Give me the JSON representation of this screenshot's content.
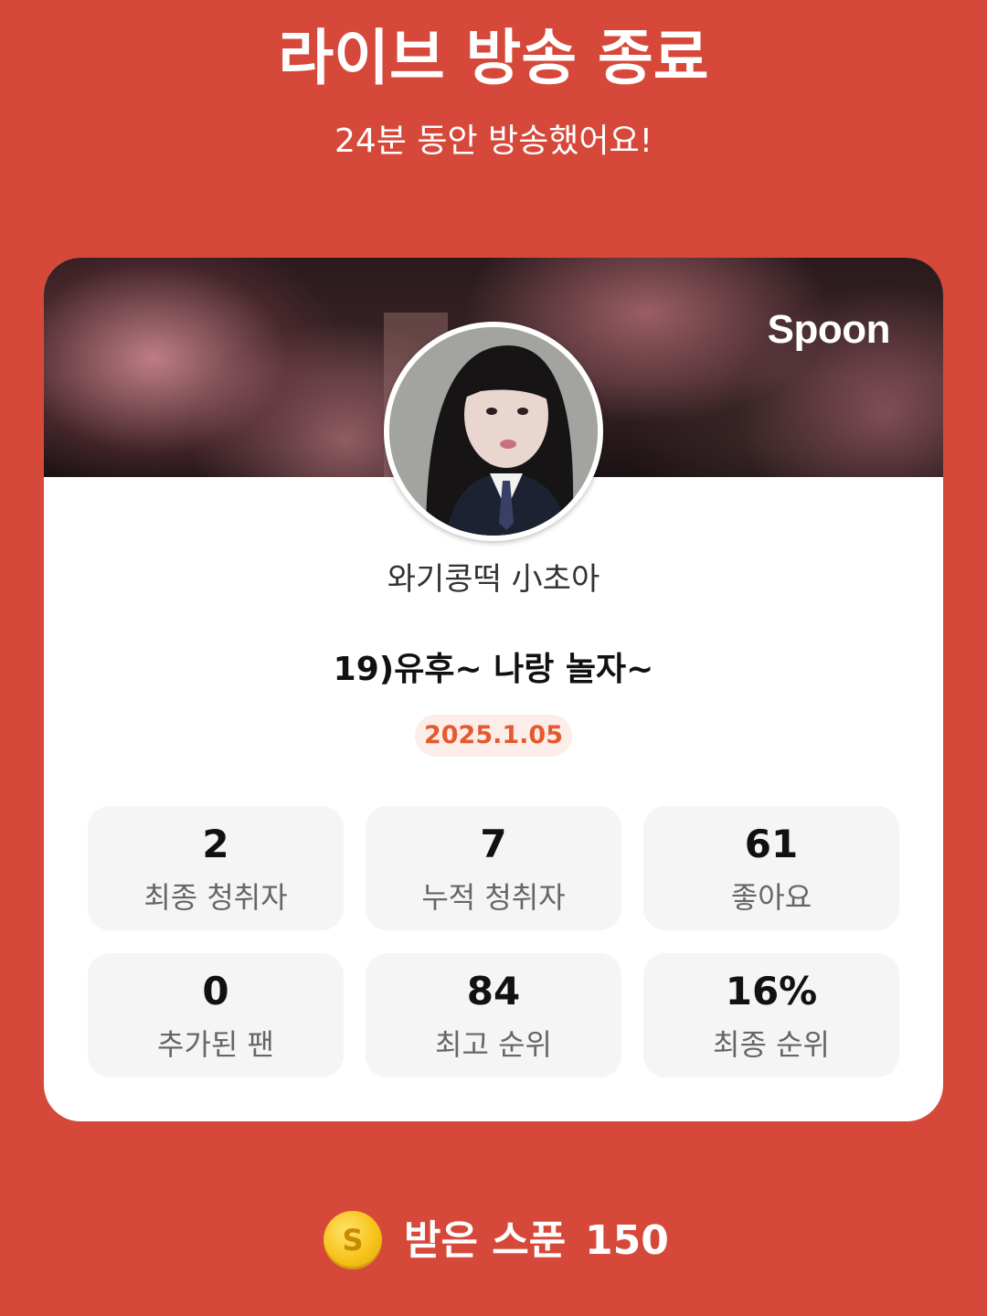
{
  "header": {
    "title": "라이브 방송 종료",
    "subtitle": "24분 동안 방송했어요!"
  },
  "card": {
    "brand_logo": "Spoon",
    "streamer_name": "와기콩떡 小초아",
    "stream_title": "19)유후~ 나랑 놀자~",
    "date": "2025.1.05"
  },
  "stats": [
    {
      "value": "2",
      "label": "최종 청취자"
    },
    {
      "value": "7",
      "label": "누적 청취자"
    },
    {
      "value": "61",
      "label": "좋아요"
    },
    {
      "value": "0",
      "label": "추가된 팬"
    },
    {
      "value": "84",
      "label": "최고 순위"
    },
    {
      "value": "16%",
      "label": "최종 순위"
    }
  ],
  "footer": {
    "coin_icon": "spoon-coin-icon",
    "coin_letter": "S",
    "label": "받은 스푼",
    "value": "150"
  },
  "colors": {
    "background": "#D6493A",
    "card": "#FFFFFF",
    "date_badge_bg": "#FDEDE8",
    "date_badge_text": "#E45A2E",
    "stat_box_bg": "#F5F5F5"
  }
}
